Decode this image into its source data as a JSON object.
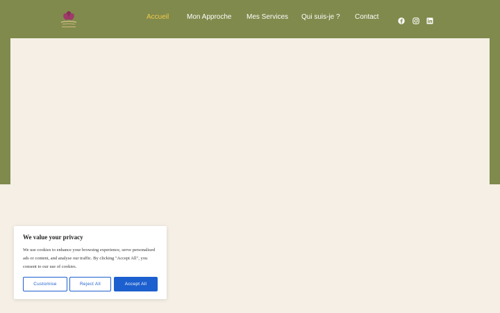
{
  "colors": {
    "header_background": "#7f8a4c",
    "page_background": "#f5efe5",
    "nav_active": "#f2c84b",
    "nav_text": "#ffffff",
    "cookie_accent": "#1c5fce"
  },
  "header": {
    "logo_icon": "lotus-logo-icon",
    "nav": [
      {
        "label": "Accueil",
        "active": true
      },
      {
        "label": "Mon Approche",
        "active": false
      },
      {
        "label": "Mes Services",
        "active": false
      },
      {
        "label": "Qui suis-je ?",
        "active": false
      },
      {
        "label": "Contact",
        "active": false
      }
    ],
    "social_icons": [
      "facebook-icon",
      "instagram-icon",
      "linkedin-icon"
    ]
  },
  "cookie_banner": {
    "title": "We value your privacy",
    "text": "We use cookies to enhance your browsing experience, serve personalised ads or content, and analyse our traffic. By clicking \"Accept All\", you consent to our use of cookies.",
    "buttons": {
      "customise": "Customise",
      "reject": "Reject All",
      "accept": "Accept All"
    }
  }
}
